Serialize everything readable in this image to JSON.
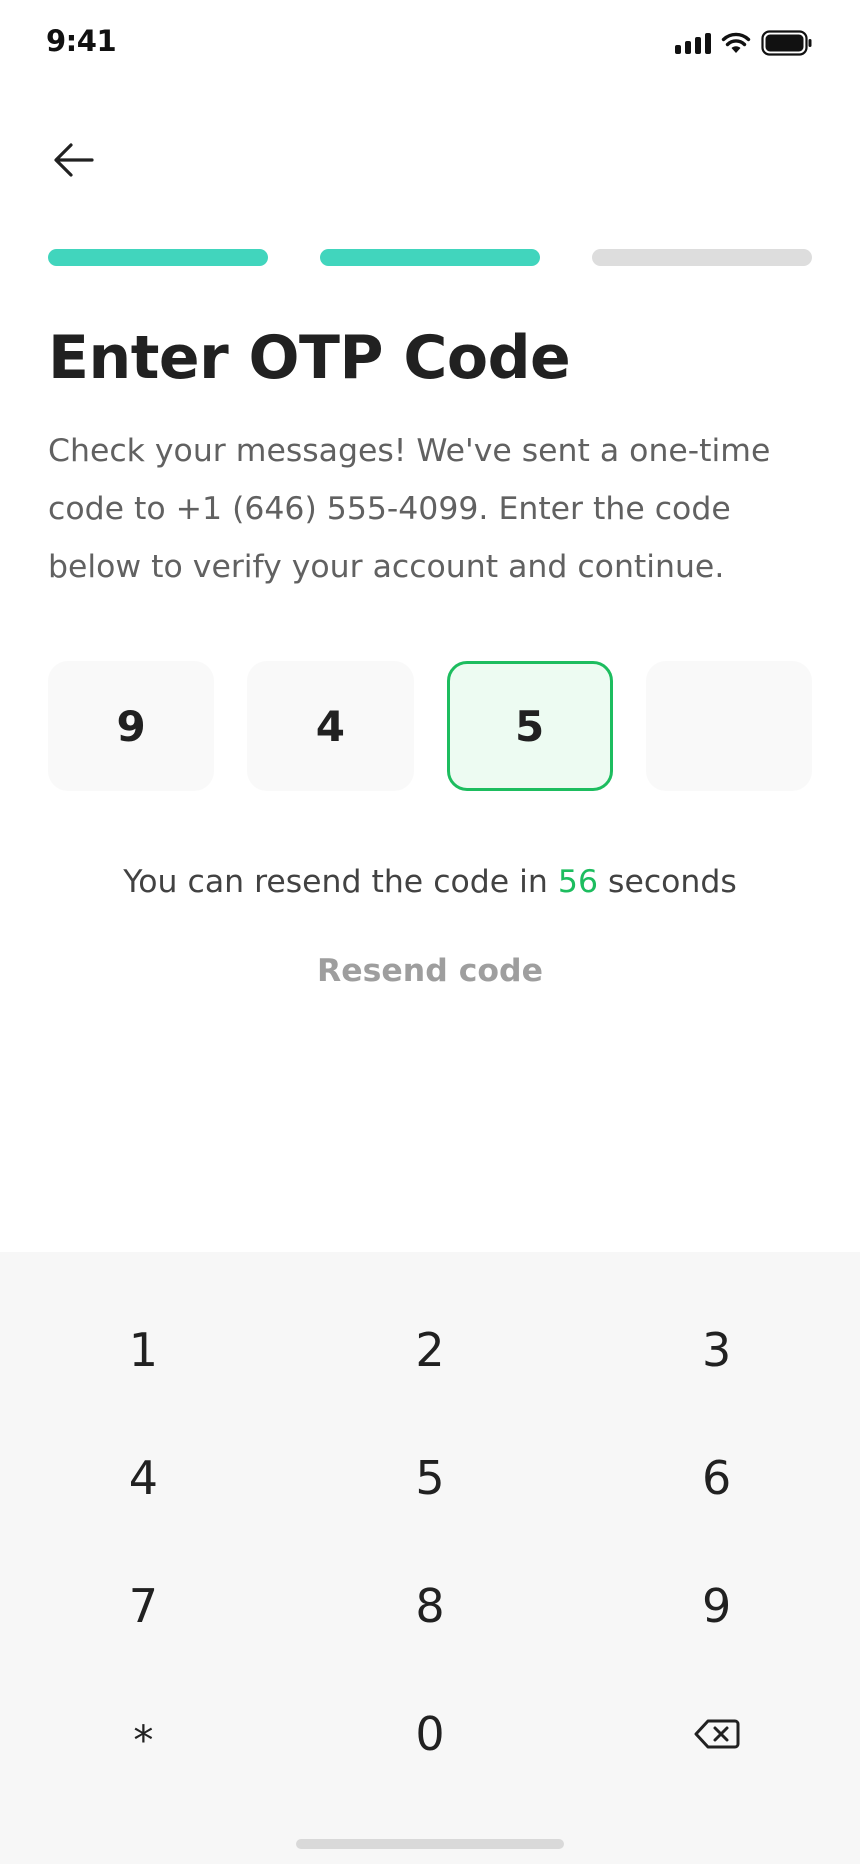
{
  "status_bar": {
    "time": "9:41"
  },
  "icons": {
    "back": "arrow-left-icon",
    "signal": "cellular-signal-icon",
    "wifi": "wifi-icon",
    "battery": "battery-icon",
    "backspace": "backspace-icon"
  },
  "progress": {
    "total_steps": 3,
    "completed_steps": 2
  },
  "colors": {
    "accent_teal": "#41d5bd",
    "accent_green": "#1dbd5f",
    "active_field_bg": "#edfbf2",
    "inactive_track": "#dddddd"
  },
  "page": {
    "title": "Enter OTP Code",
    "description": "Check your messages! We've sent a one-time code to +1 (646) 555-4099. Enter the code below to verify your account and continue."
  },
  "otp": {
    "digits": [
      "9",
      "4",
      "5",
      ""
    ],
    "active_index": 2
  },
  "resend": {
    "prefix": "You can resend the code in",
    "countdown": "56",
    "suffix": "seconds",
    "link_label": "Resend code"
  },
  "keypad": {
    "keys": [
      "1",
      "2",
      "3",
      "4",
      "5",
      "6",
      "7",
      "8",
      "9",
      "*",
      "0",
      "⌫"
    ]
  }
}
